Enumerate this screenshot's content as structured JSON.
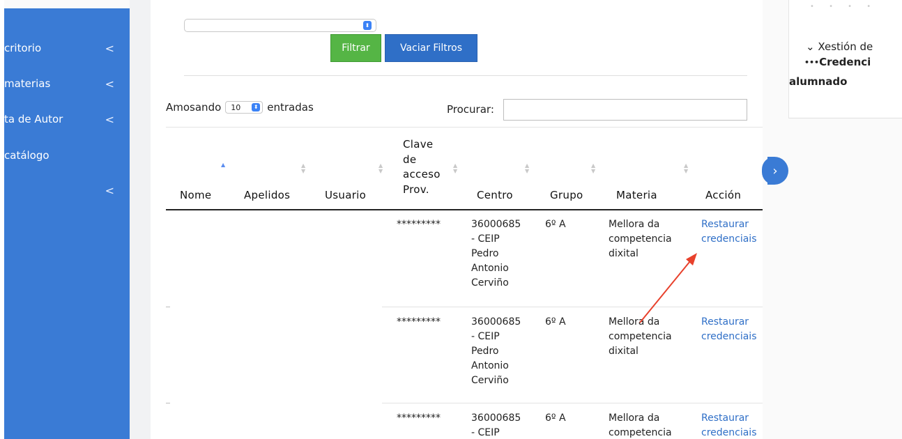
{
  "sidebar": {
    "items": [
      {
        "label": "critorio",
        "has_chevron": true
      },
      {
        "label": "materias",
        "has_chevron": true
      },
      {
        "label": "ta de Autor",
        "has_chevron": true
      },
      {
        "label": "catálogo",
        "has_chevron": false
      },
      {
        "label": "",
        "has_chevron": true
      }
    ],
    "chevron_glyph": "<"
  },
  "filters": {
    "filter_label": "Filtrar",
    "clear_label": "Vaciar Filtros",
    "select_value": ""
  },
  "table_controls": {
    "show_prefix": "Amosando",
    "page_length": "10",
    "show_suffix": "entradas",
    "search_label": "Procurar:",
    "search_value": ""
  },
  "table": {
    "columns": [
      {
        "key": "nome",
        "label": "Nome"
      },
      {
        "key": "apelidos",
        "label": "Apelidos"
      },
      {
        "key": "usuario",
        "label": "Usuario"
      },
      {
        "key": "clave",
        "label_lines": [
          "Clave",
          "de",
          "acceso",
          "Prov."
        ]
      },
      {
        "key": "centro",
        "label": "Centro"
      },
      {
        "key": "grupo",
        "label": "Grupo"
      },
      {
        "key": "materia",
        "label": "Materia"
      },
      {
        "key": "accion",
        "label": "Acción"
      }
    ],
    "rows": [
      {
        "nome": "",
        "apelidos": "",
        "usuario": "",
        "clave": "*********",
        "centro_lines": [
          "36000685",
          "- CEIP",
          "Pedro",
          "Antonio",
          "Cerviño"
        ],
        "grupo": "6º A",
        "materia_lines": [
          "Mellora da",
          "competencia",
          "dixital"
        ],
        "accion_lines": [
          "Restaurar",
          "credenciais"
        ]
      },
      {
        "nome": "",
        "apelidos": "",
        "usuario": "",
        "clave": "*********",
        "centro_lines": [
          "36000685",
          "- CEIP",
          "Pedro",
          "Antonio",
          "Cerviño"
        ],
        "grupo": "6º A",
        "materia_lines": [
          "Mellora da",
          "competencia",
          "dixital"
        ],
        "accion_lines": [
          "Restaurar",
          "credenciais"
        ]
      },
      {
        "nome": "",
        "apelidos": "",
        "usuario": "",
        "clave": "*********",
        "centro_lines": [
          "36000685",
          "- CEIP"
        ],
        "grupo": "6º A",
        "materia_lines": [
          "Mellora da",
          "competencia"
        ],
        "accion_lines": [
          "Restaurar",
          "credenciais"
        ]
      }
    ]
  },
  "right_panel": {
    "breadcrumb_1": "Xestión de",
    "breadcrumb_2": "Credenci",
    "breadcrumb_3": "alumnado",
    "chevron_glyph": "⌄",
    "dots_glyph": "•••"
  },
  "colors": {
    "sidebar": "#3a7bd5",
    "filter_button": "#55b545",
    "clear_button": "#2f6fc7",
    "link": "#2f6fc7",
    "annotation_arrow": "#e8412c"
  }
}
